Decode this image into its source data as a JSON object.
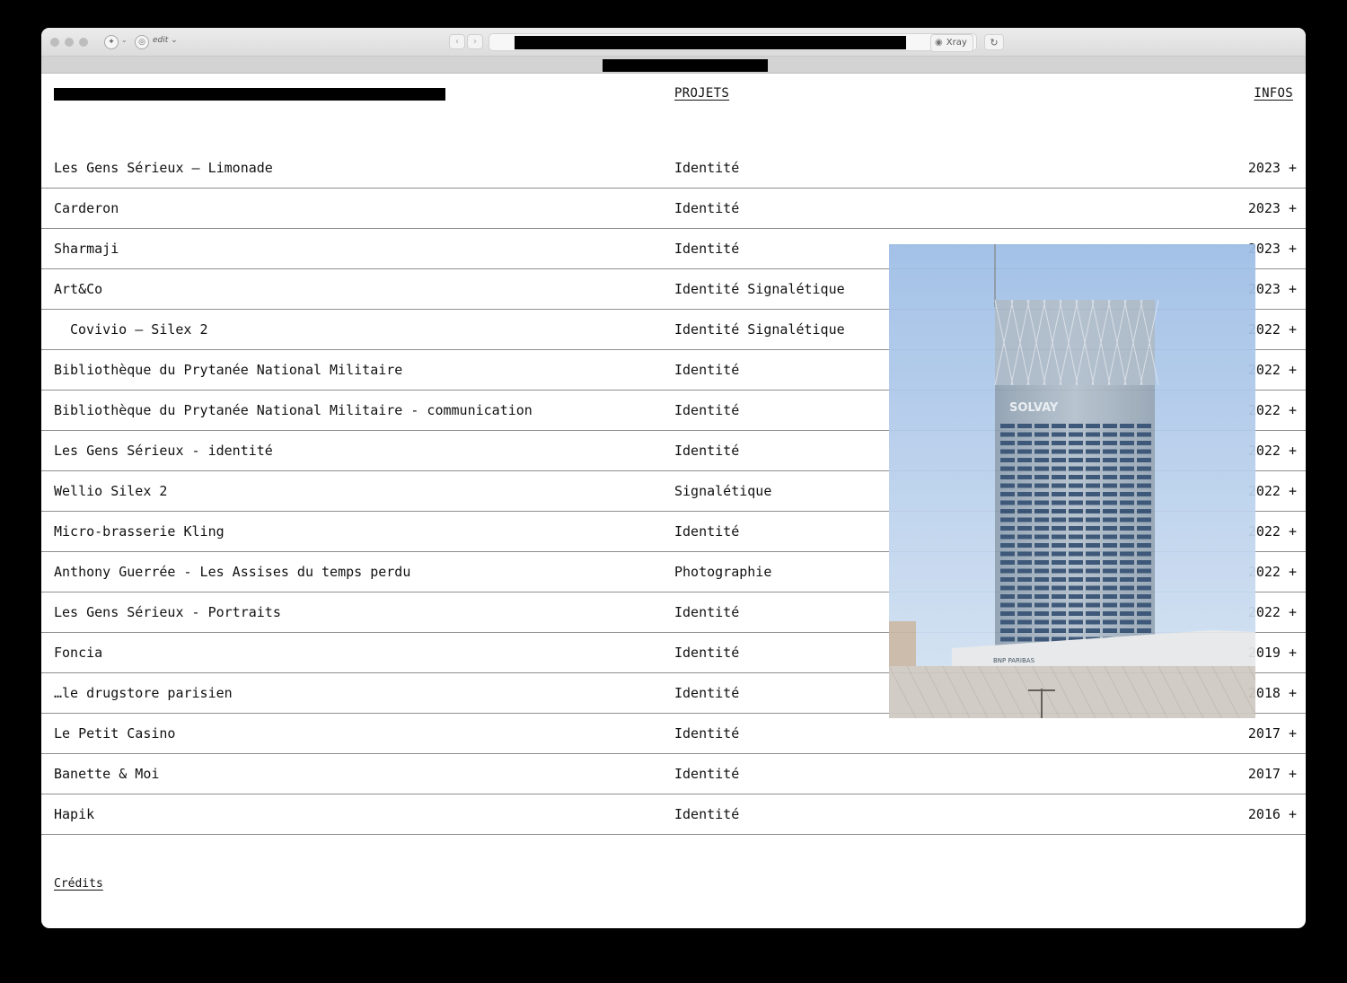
{
  "browser": {
    "edit_label": "edit",
    "xray_label": "Xray",
    "back_icon": "chevron-left-icon",
    "forward_icon": "chevron-right-icon",
    "reload_icon": "reload-icon"
  },
  "nav": {
    "projets": "PROJETS",
    "infos": "INFOS"
  },
  "projects": [
    {
      "name": "Les Gens Sérieux — Limonade",
      "category": "Identité",
      "year": "2023 +"
    },
    {
      "name": "Carderon",
      "category": "Identité",
      "year": "2023 +"
    },
    {
      "name": "Sharmaji",
      "category": "Identité",
      "year": "2023 +"
    },
    {
      "name": "Art&Co",
      "category": "Identité Signalétique",
      "year": "2023 +"
    },
    {
      "name": "Covivio — Silex 2",
      "category": "Identité Signalétique",
      "year": "2022 +"
    },
    {
      "name": "Bibliothèque du Prytanée National Militaire",
      "category": "Identité",
      "year": "2022 +"
    },
    {
      "name": "Bibliothèque du Prytanée National Militaire - communication",
      "category": "Identité",
      "year": "2022 +"
    },
    {
      "name": "Les Gens Sérieux - identité",
      "category": "Identité",
      "year": "2022 +"
    },
    {
      "name": "Wellio Silex 2",
      "category": "Signalétique",
      "year": "2022 +"
    },
    {
      "name": "Micro-brasserie Kling",
      "category": "Identité",
      "year": "2022 +"
    },
    {
      "name": "Anthony Guerrée - Les Assises du temps perdu",
      "category": "Photographie",
      "year": "2022 +"
    },
    {
      "name": "Les Gens Sérieux - Portraits",
      "category": "Identité",
      "year": "2022 +"
    },
    {
      "name": "Foncia",
      "category": "Identité",
      "year": "2019 +"
    },
    {
      "name": "…le drugstore parisien",
      "category": "Identité",
      "year": "2018 +"
    },
    {
      "name": "Le Petit Casino",
      "category": "Identité",
      "year": "2017 +"
    },
    {
      "name": "Banette & Moi",
      "category": "Identité",
      "year": "2017 +"
    },
    {
      "name": "Hapik",
      "category": "Identité",
      "year": "2016 +"
    }
  ],
  "preview": {
    "building_sign": "SOLVAY",
    "bank_sign": "BNP PARIBAS"
  },
  "footer": {
    "credits": "Crédits"
  }
}
